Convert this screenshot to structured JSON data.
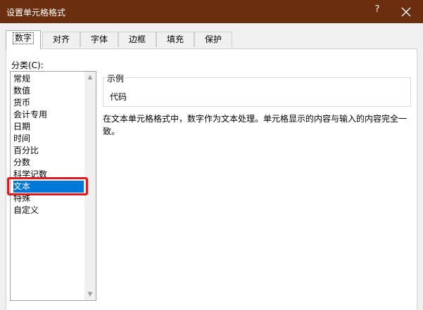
{
  "window": {
    "title": "设置单元格格式",
    "help_label": "?"
  },
  "tabs": [
    {
      "label": "数字"
    },
    {
      "label": "对齐"
    },
    {
      "label": "字体"
    },
    {
      "label": "边框"
    },
    {
      "label": "填充"
    },
    {
      "label": "保护"
    }
  ],
  "category": {
    "label": "分类(C):",
    "items": [
      "常规",
      "数值",
      "货币",
      "会计专用",
      "日期",
      "时间",
      "百分比",
      "分数",
      "科学记数",
      "文本",
      "特殊",
      "自定义"
    ],
    "selected_index": 9
  },
  "sample": {
    "legend": "示例",
    "value": "代码"
  },
  "description": "在文本单元格格式中，数字作为文本处理。单元格显示的内容与输入的内容完全一致。",
  "colors": {
    "titlebar": "#6b2f10",
    "selection": "#0078d7",
    "highlight_box": "#e0191f"
  }
}
